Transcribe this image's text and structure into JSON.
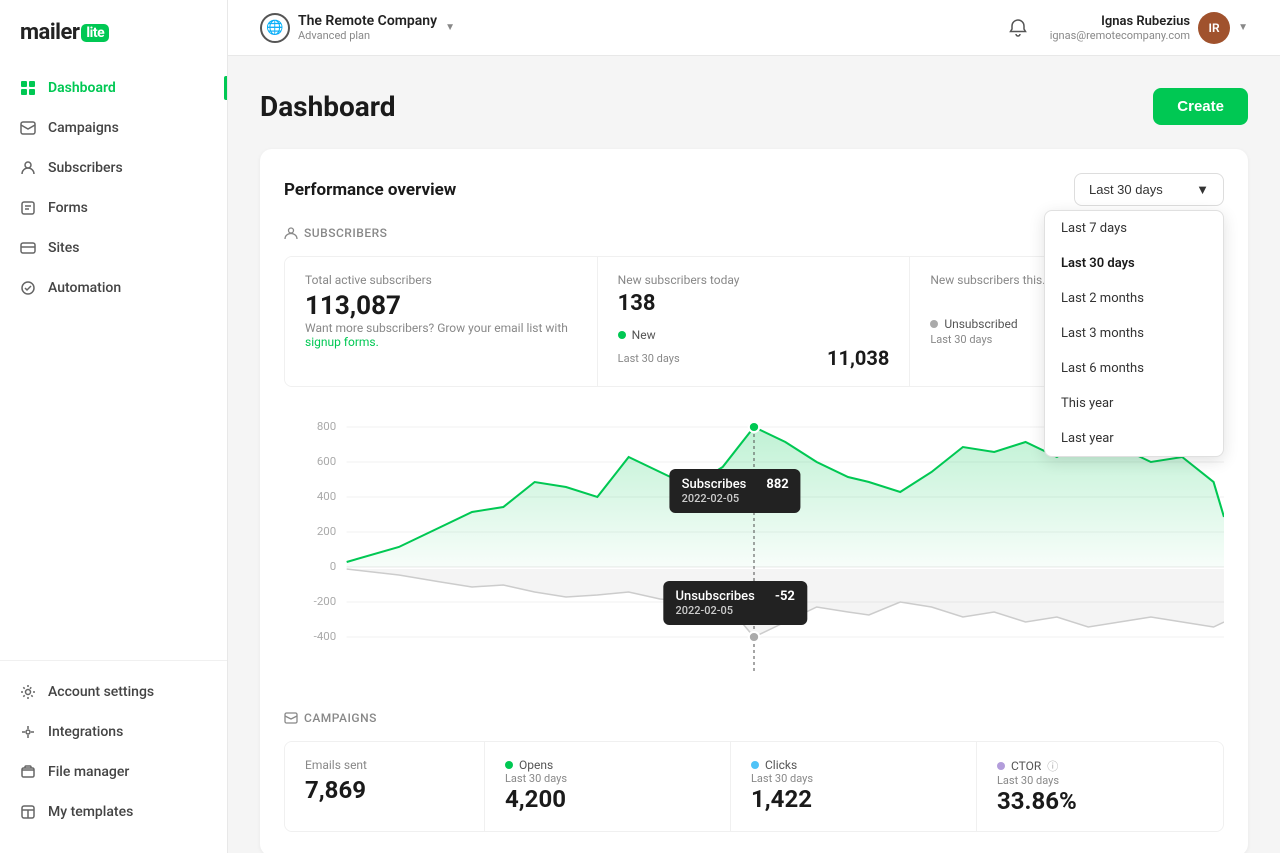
{
  "logo": {
    "text": "mailer",
    "badge": "lite"
  },
  "sidebar": {
    "items": [
      {
        "id": "dashboard",
        "label": "Dashboard",
        "icon": "dashboard",
        "active": true
      },
      {
        "id": "campaigns",
        "label": "Campaigns",
        "icon": "campaigns",
        "active": false
      },
      {
        "id": "subscribers",
        "label": "Subscribers",
        "icon": "subscribers",
        "active": false
      },
      {
        "id": "forms",
        "label": "Forms",
        "icon": "forms",
        "active": false
      },
      {
        "id": "sites",
        "label": "Sites",
        "icon": "sites",
        "active": false
      },
      {
        "id": "automation",
        "label": "Automation",
        "icon": "automation",
        "active": false
      }
    ],
    "bottom": [
      {
        "id": "account-settings",
        "label": "Account settings",
        "icon": "account"
      },
      {
        "id": "integrations",
        "label": "Integrations",
        "icon": "integrations"
      },
      {
        "id": "file-manager",
        "label": "File manager",
        "icon": "file"
      },
      {
        "id": "my-templates",
        "label": "My templates",
        "icon": "templates"
      }
    ]
  },
  "topbar": {
    "company": "The Remote Company",
    "plan": "Advanced plan",
    "bell_icon": "🔔",
    "user_name": "Ignas Rubezius",
    "user_email": "ignas@remotecompany.com"
  },
  "page": {
    "title": "Dashboard",
    "create_label": "Create"
  },
  "performance": {
    "section_title": "Performance overview",
    "dropdown_selected": "Last 30 days",
    "dropdown_options": [
      {
        "value": "last7",
        "label": "Last 7 days"
      },
      {
        "value": "last30",
        "label": "Last 30 days"
      },
      {
        "value": "last2m",
        "label": "Last 2 months"
      },
      {
        "value": "last3m",
        "label": "Last 3 months"
      },
      {
        "value": "last6m",
        "label": "Last 6 months"
      },
      {
        "value": "thisyear",
        "label": "This year"
      },
      {
        "value": "lastyear",
        "label": "Last year"
      }
    ]
  },
  "subscribers_section": {
    "label": "Subscribers",
    "total_label": "Total active subscribers",
    "total_value": "113,087",
    "hint": "Want more subscribers? Grow your email list with signup forms.",
    "hint_link": "signup forms.",
    "new_label": "New subscribers today",
    "new_value": "138",
    "new_dot": "New",
    "new_period": "Last 30 days",
    "new_30_value": "11,038",
    "unsub_label": "Unsubscribed",
    "unsub_period": "Last 30 days",
    "unsub_third_label": "New subscribers this..."
  },
  "chart": {
    "y_labels": [
      "800",
      "600",
      "400",
      "200",
      "0",
      "-200",
      "-400"
    ],
    "tooltip_sub": {
      "label": "Subscribes",
      "value": "882",
      "date": "2022-02-05"
    },
    "tooltip_unsub": {
      "label": "Unsubscribes",
      "value": "-52",
      "date": "2022-02-05"
    }
  },
  "campaigns_section": {
    "label": "Campaigns",
    "emails_sent_label": "Emails sent",
    "emails_sent_value": "7,869",
    "opens_label": "Opens",
    "opens_period": "Last 30 days",
    "opens_value": "4,200",
    "clicks_label": "Clicks",
    "clicks_period": "Last 30 days",
    "clicks_value": "1,422",
    "ctor_label": "CTOR",
    "ctor_period": "Last 30 days",
    "ctor_value": "33.86%"
  }
}
